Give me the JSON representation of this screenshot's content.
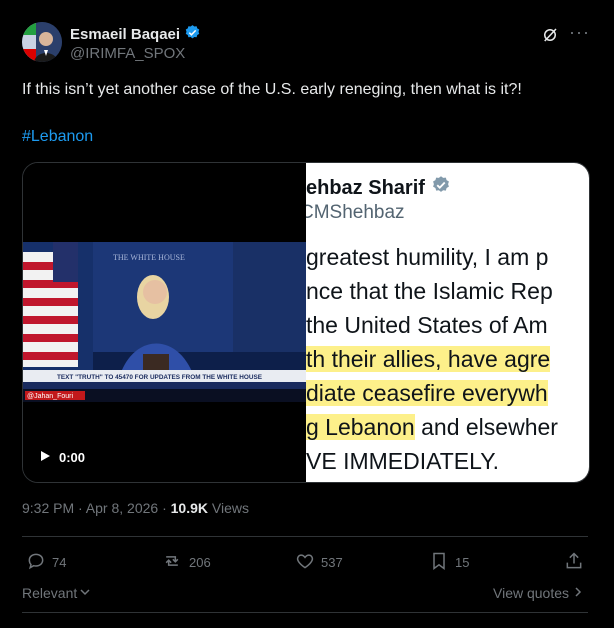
{
  "author": {
    "name": "Esmaeil Baqaei",
    "handle": "@IRIMFA_SPOX"
  },
  "tweet": {
    "text": "If this isn’t yet another case of the U.S. early reneging, then what is it?!",
    "hashtag": "#Lebanon"
  },
  "video": {
    "chyron": "TEXT \"TRUTH\" TO 45470 FOR UPDATES FROM THE WHITE HOUSE",
    "watermark": "@Jahan_Fouri",
    "time": "0:00",
    "backdrop_text": "THE WHITE HOUSE"
  },
  "embedded_image": {
    "name": "ehbaz Sharif",
    "handle": "CMShehbaz",
    "lines": [
      {
        "text": " greatest humility, I am p",
        "highlight": false
      },
      {
        "text": "nce that the Islamic Rep",
        "highlight": false
      },
      {
        "text": "the United States of Am",
        "highlight": false
      },
      {
        "text": "th their allies, have agre",
        "highlight": true
      },
      {
        "text": "diate ceasefire everywh",
        "highlight": true
      },
      {
        "text": "g Lebanon",
        "highlight": true,
        "suffix": " and elsewher"
      },
      {
        "text": "VE IMMEDIATELY.",
        "highlight": false
      }
    ]
  },
  "meta": {
    "time": "9:32 PM · Apr 8, 2026 · ",
    "views_count": "10.9K",
    "views_label": " Views"
  },
  "actions": {
    "replies": "74",
    "reposts": "206",
    "likes": "537",
    "bookmarks": "15"
  },
  "footer": {
    "sort_label": "Relevant",
    "view_quotes": "View quotes"
  },
  "colors": {
    "accent": "#1d9bf0",
    "muted": "#71767b",
    "highlight": "#fdf08a"
  }
}
